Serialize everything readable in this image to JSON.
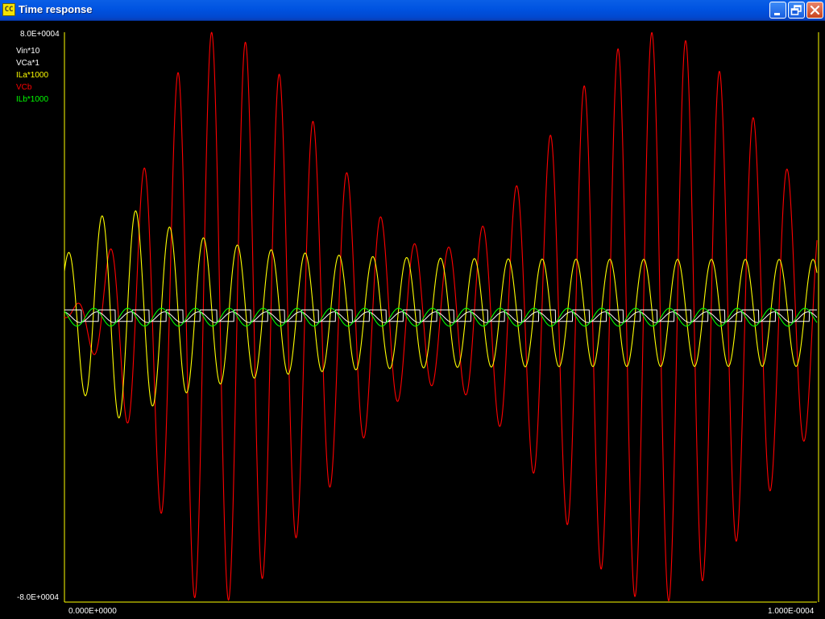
{
  "window": {
    "title": "Time response",
    "icon_text": "CC",
    "buttons": [
      "minimize",
      "restore",
      "close"
    ]
  },
  "axes": {
    "y_max_label": "8.0E+0004",
    "y_min_label": "-8.0E+0004",
    "x_min_label": "0.000E+0000",
    "x_max_label": "1.000E-0004"
  },
  "legend": [
    {
      "label": "Vin*10",
      "color": "#ffffff"
    },
    {
      "label": "VCa*1",
      "color": "#ffffff"
    },
    {
      "label": "ILa*1000",
      "color": "#ffff00"
    },
    {
      "label": "VCb",
      "color": "#ff0000"
    },
    {
      "label": "ILb*1000",
      "color": "#00ff00"
    }
  ],
  "chart_data": {
    "type": "line",
    "x_range": [
      0,
      0.0001
    ],
    "y_range": [
      -80000,
      80000
    ],
    "x_min_label": "0.000E+0000",
    "x_max_label": "1.000E-0004",
    "y_max_label": "8.0E+0004",
    "y_min_label": "-8.0E+0004",
    "background": "#000000",
    "axis_color": "#ffff00",
    "series": [
      {
        "name": "Vin*10",
        "color": "#ffffff",
        "shape": "square wave",
        "amplitude": 2000,
        "period": 4.5e-06
      },
      {
        "name": "VCa*1",
        "color": "#ffffff",
        "shape": "small sine",
        "amplitude": 1500,
        "period": 4.5e-06
      },
      {
        "name": "ILa*1000",
        "color": "#ffff00",
        "shape": "sine with decaying transient",
        "peak": 47000,
        "steady_amplitude": 15000,
        "period": 4.5e-06
      },
      {
        "name": "VCb",
        "color": "#ff0000",
        "shape": "beating sine",
        "peak": 80000,
        "period": 4.5e-06
      },
      {
        "name": "ILb*1000",
        "color": "#00ff00",
        "shape": "small sine",
        "amplitude": 2500,
        "period": 4.5e-06
      }
    ]
  }
}
